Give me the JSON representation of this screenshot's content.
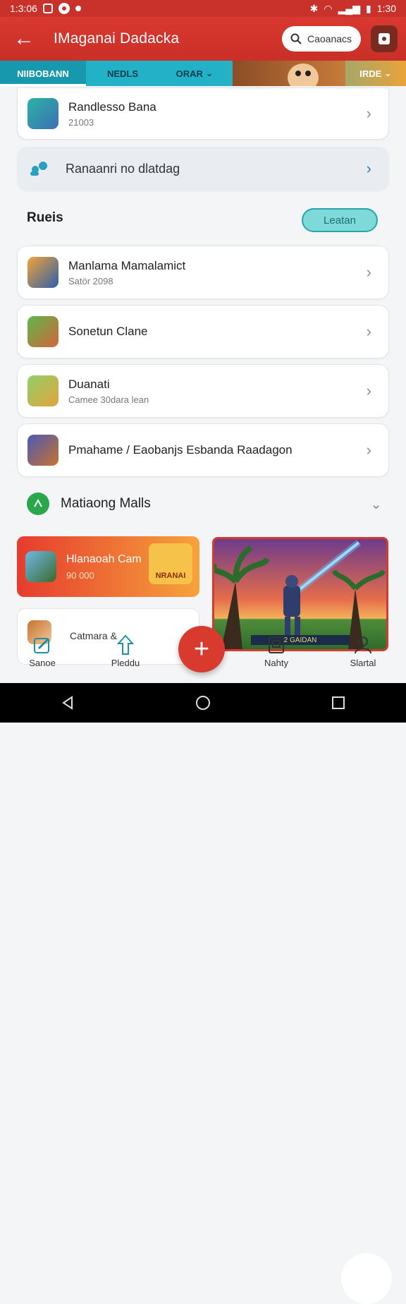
{
  "status_bar": {
    "left_time": "1:3:06",
    "right_time": "1:30"
  },
  "app_bar": {
    "title": "IMaganai Dadacka",
    "search_label": "Caoanacs"
  },
  "tabs": [
    {
      "label": "NIIBOBANN",
      "active": true
    },
    {
      "label": "NEDLS",
      "active": false
    },
    {
      "label": "ORAR",
      "active": false
    },
    {
      "label": "IRDE",
      "active": false
    }
  ],
  "top_card": {
    "title": "Randlesso Bana",
    "subtitle": "21003"
  },
  "info_card": {
    "text": "Ranaanri no dlatdag"
  },
  "section": {
    "title": "Rueis",
    "action_label": "Leatan"
  },
  "list_items": [
    {
      "title": "Manlama Mamalamict",
      "subtitle": "Satör 2098"
    },
    {
      "title": "Sonetun Clane",
      "subtitle": ""
    },
    {
      "title": "Duanati",
      "subtitle": "Camee 30dara lean"
    },
    {
      "title": "Pmahame / Eaobanjs Esbanda Raadagon",
      "subtitle": ""
    }
  ],
  "malls": {
    "title": "Matiaong Malls"
  },
  "promo": {
    "title": "Hlanaoah Cam",
    "subtitle": "90 000",
    "badge": "NRANAI"
  },
  "art_card": {
    "badge_text": "2 GAIDAN"
  },
  "small_card": {
    "title": "Catmara &"
  },
  "bottom_nav": [
    {
      "label": "Sanoe"
    },
    {
      "label": "Pleddu"
    },
    {
      "label": "Nahty"
    },
    {
      "label": "Slartal"
    }
  ],
  "colors": {
    "primary": "#d9382f",
    "teal": "#22b1c6",
    "accent": "#f6a33b"
  }
}
